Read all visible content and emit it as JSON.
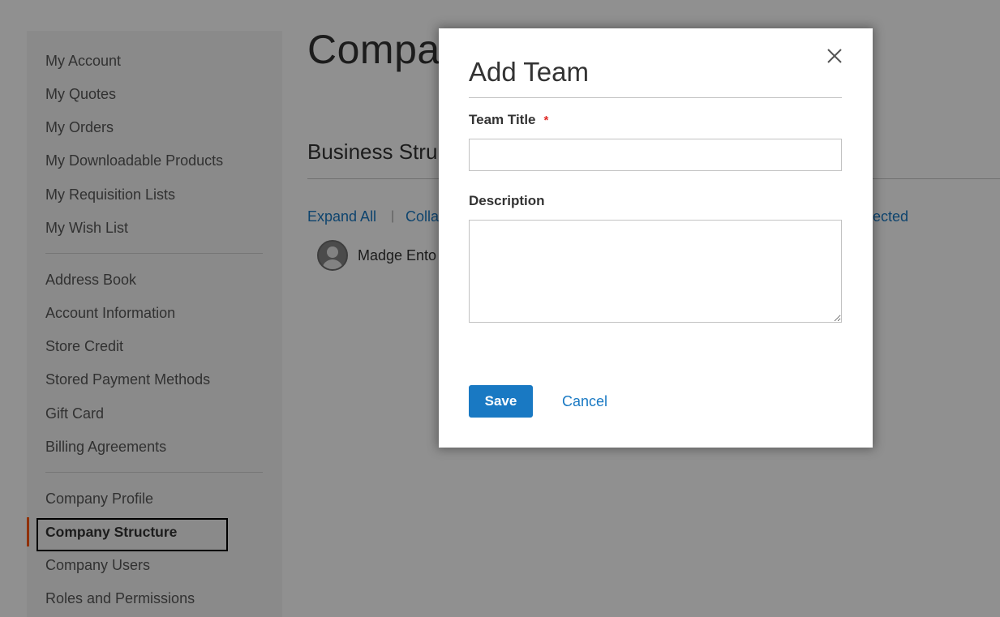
{
  "sidebar": {
    "group1": [
      "My Account",
      "My Quotes",
      "My Orders",
      "My Downloadable Products",
      "My Requisition Lists",
      "My Wish List"
    ],
    "group2": [
      "Address Book",
      "Account Information",
      "Store Credit",
      "Stored Payment Methods",
      "Gift Card",
      "Billing Agreements"
    ],
    "group3": [
      "Company Profile",
      "Company Structure",
      "Company Users",
      "Roles and Permissions"
    ],
    "active_item": "Company Structure"
  },
  "main": {
    "title": "Compa",
    "section_title": "Business Stru",
    "expand_all": "Expand All",
    "separator": "|",
    "collapse_partial": "Colla",
    "selected_partial": "lected",
    "tree_node_label": "Madge Ento"
  },
  "modal": {
    "title": "Add Team",
    "team_title_label": "Team Title",
    "required_mark": "*",
    "team_title_value": "",
    "description_label": "Description",
    "description_value": "",
    "save_label": "Save",
    "cancel_label": "Cancel"
  },
  "colors": {
    "accent": "#1979c3",
    "active_marker": "#ff5501",
    "required": "#e02b27"
  },
  "icons": {
    "close": "close-icon",
    "user": "user-avatar-icon"
  }
}
